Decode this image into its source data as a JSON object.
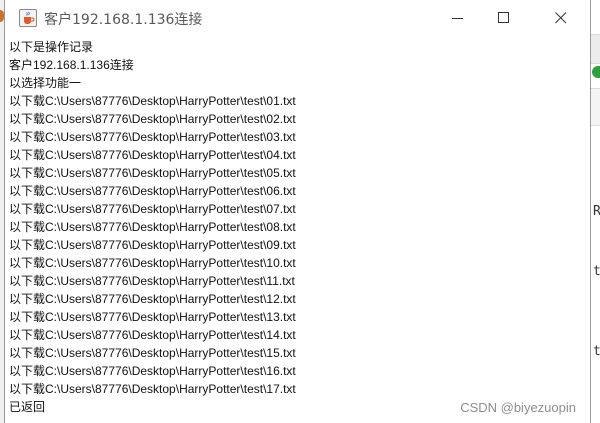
{
  "window": {
    "title": "客户192.168.1.136连接",
    "app_icon": "java-cup-icon",
    "controls": {
      "minimize": "minimize-icon",
      "maximize": "maximize-icon",
      "close": "close-icon"
    }
  },
  "log": {
    "lines": [
      "以下是操作记录",
      "客户192.168.1.136连接",
      "以选择功能一",
      "以下载C:\\Users\\87776\\Desktop\\HarryPotter\\test\\01.txt",
      "以下载C:\\Users\\87776\\Desktop\\HarryPotter\\test\\02.txt",
      "以下载C:\\Users\\87776\\Desktop\\HarryPotter\\test\\03.txt",
      "以下载C:\\Users\\87776\\Desktop\\HarryPotter\\test\\04.txt",
      "以下载C:\\Users\\87776\\Desktop\\HarryPotter\\test\\05.txt",
      "以下载C:\\Users\\87776\\Desktop\\HarryPotter\\test\\06.txt",
      "以下载C:\\Users\\87776\\Desktop\\HarryPotter\\test\\07.txt",
      "以下载C:\\Users\\87776\\Desktop\\HarryPotter\\test\\08.txt",
      "以下载C:\\Users\\87776\\Desktop\\HarryPotter\\test\\09.txt",
      "以下载C:\\Users\\87776\\Desktop\\HarryPotter\\test\\10.txt",
      "以下载C:\\Users\\87776\\Desktop\\HarryPotter\\test\\11.txt",
      "以下载C:\\Users\\87776\\Desktop\\HarryPotter\\test\\12.txt",
      "以下载C:\\Users\\87776\\Desktop\\HarryPotter\\test\\13.txt",
      "以下载C:\\Users\\87776\\Desktop\\HarryPotter\\test\\14.txt",
      "以下载C:\\Users\\87776\\Desktop\\HarryPotter\\test\\15.txt",
      "以下载C:\\Users\\87776\\Desktop\\HarryPotter\\test\\16.txt",
      "以下载C:\\Users\\87776\\Desktop\\HarryPotter\\test\\17.txt",
      "已返回"
    ]
  },
  "background_app": {
    "right_edge_chars": [
      "R",
      "t",
      "t"
    ]
  },
  "watermark": "CSDN @biyezuopin"
}
